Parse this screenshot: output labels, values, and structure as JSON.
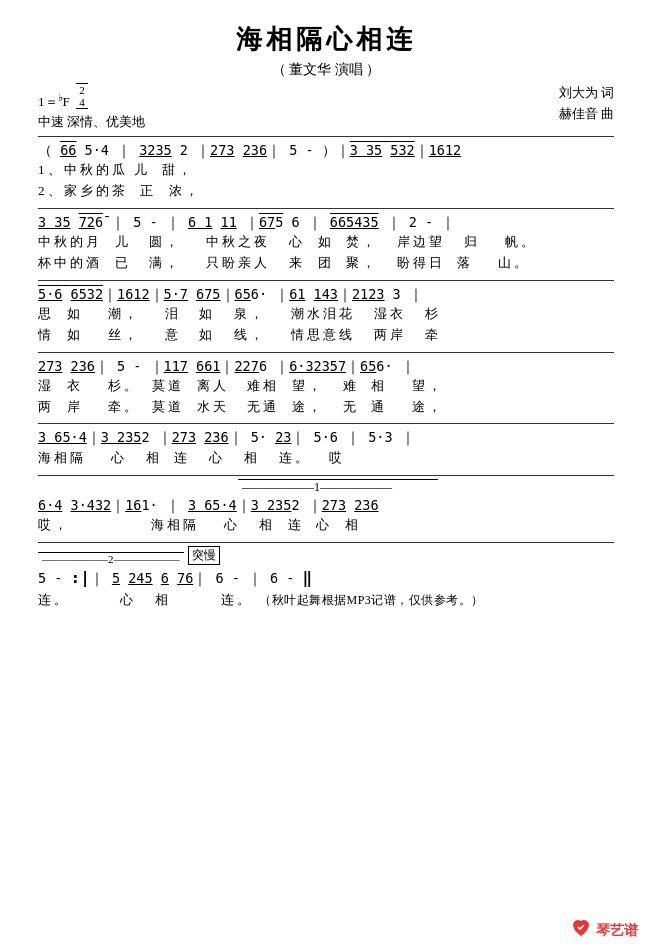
{
  "title": "海相隔心相连",
  "subtitle": "（ 董文华 演唱 ）",
  "composer_lyricist": "刘大为 词",
  "composer_music": "赫佳音 曲",
  "tempo": "1＝♭F",
  "time_sig": "2/4",
  "tempo_desc": "中速 深情、优美地",
  "sections": [
    {
      "music": "（ (66 5·4 | 3235 2 |273 236| 5 - )|3 35 532|1612",
      "lyrics": "1、中秋的瓜 儿 甜，\n2、家乡的茶 正 浓，"
    }
  ],
  "logo_text": "琴艺谱",
  "footer_note": "（秋叶起舞根据MP3记谱，仅供参考。）"
}
